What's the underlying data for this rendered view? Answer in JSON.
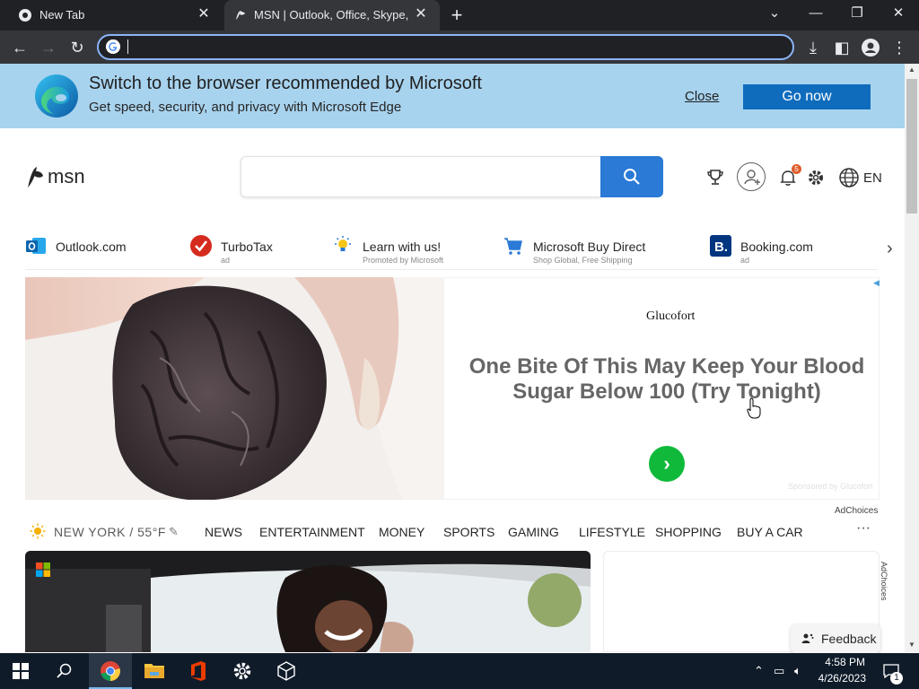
{
  "browser": {
    "tabs": [
      {
        "label": "New Tab"
      },
      {
        "label": "MSN | Outlook, Office, Skype, Bing"
      }
    ],
    "address": ""
  },
  "banner": {
    "title": "Switch to the browser recommended by Microsoft",
    "subtitle": "Get speed, security, and privacy with Microsoft Edge",
    "close_label": "Close",
    "go_label": "Go now"
  },
  "header": {
    "logo_text": "msn",
    "search_placeholder": "",
    "notification_count": "5",
    "language": "EN"
  },
  "quick_links": [
    {
      "label": "Outlook.com",
      "sub": ""
    },
    {
      "label": "TurboTax",
      "sub": "ad"
    },
    {
      "label": "Learn with us!",
      "sub": "Promoted by Microsoft"
    },
    {
      "label": "Microsoft Buy Direct",
      "sub": "Shop Global, Free Shipping"
    },
    {
      "label": "Booking.com",
      "sub": "ad"
    }
  ],
  "ad": {
    "brand": "Glucofort",
    "headline": "One Bite Of This May Keep Your Blood Sugar Below 100 (Try Tonight)",
    "sponsored": "Sponsored by Glucofort"
  },
  "nav": {
    "weather": "NEW YORK / 55°F",
    "items": [
      "NEWS",
      "ENTERTAINMENT",
      "MONEY",
      "SPORTS",
      "GAMING",
      "LIFESTYLE",
      "SHOPPING",
      "BUY A CAR"
    ],
    "more": "···",
    "adchoices": "AdChoices"
  },
  "side_ad": {
    "adchoices": "AdChoices"
  },
  "feedback_label": "Feedback",
  "taskbar": {
    "time": "4:58 PM",
    "date": "4/26/2023",
    "notifications": "1"
  },
  "colors": {
    "banner_bg": "#a8d3ee",
    "go_button": "#0f6cbd",
    "search_button": "#2a7ad6",
    "ad_arrow": "#10b93a",
    "taskbar": "#101b2a"
  }
}
